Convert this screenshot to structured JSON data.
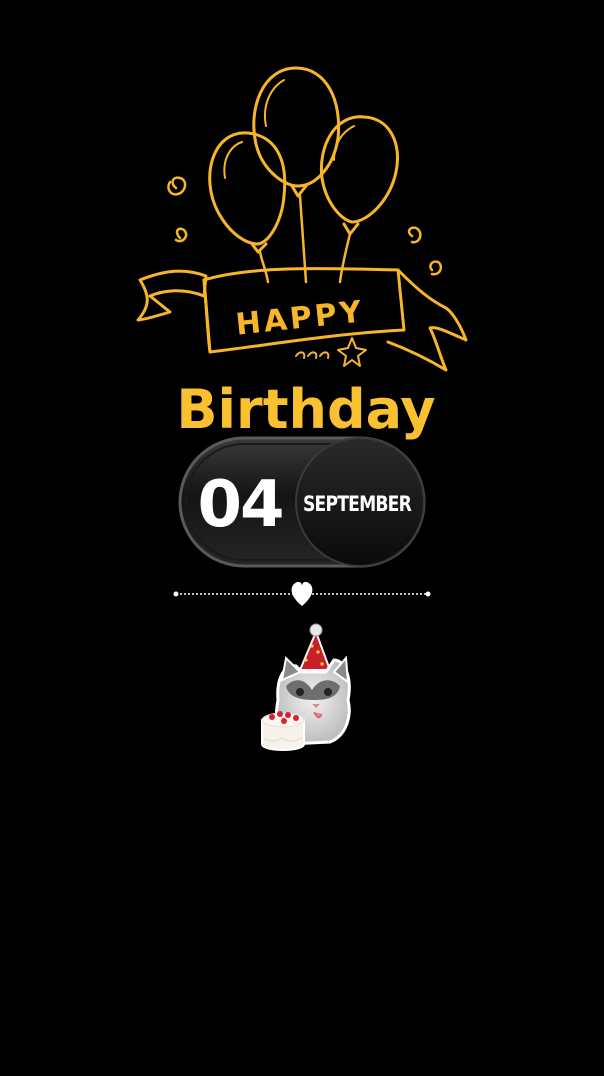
{
  "card": {
    "banner_text": "HAPPY",
    "headline": "Birthday",
    "day": "04",
    "month": "SEPTEMBER"
  },
  "icons": {
    "balloons": "balloons-icon",
    "divider": "heart-icon",
    "sticker": "cat-with-party-hat-and-cake"
  },
  "colors": {
    "background": "#000000",
    "gold": "#f6b52a",
    "white": "#ffffff"
  }
}
